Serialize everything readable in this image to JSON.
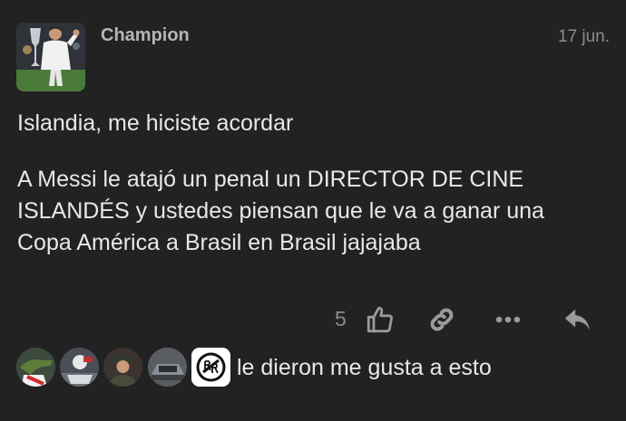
{
  "post": {
    "author": "Champion",
    "date": "17 jun.",
    "paragraphs": [
      "Islandia, me hiciste acordar",
      "A Messi le atajó un penal un DIRECTOR DE CINE ISLANDÉS y ustedes piensan que le va a ganar una Copa América a Brasil en Brasil jajajaba"
    ]
  },
  "actions": {
    "like_count": "5",
    "icons": [
      "like-icon",
      "link-icon",
      "more-icon",
      "reply-icon"
    ]
  },
  "likers": {
    "text": "le dieron me gusta a esto",
    "avatars": [
      "crocodile-avatar",
      "racing-avatar",
      "soldier-avatar",
      "car-avatar",
      "river-plate-logo-avatar"
    ]
  },
  "colors": {
    "background": "#222222",
    "text": "#e8e8e8",
    "muted": "#8d8d8d"
  }
}
